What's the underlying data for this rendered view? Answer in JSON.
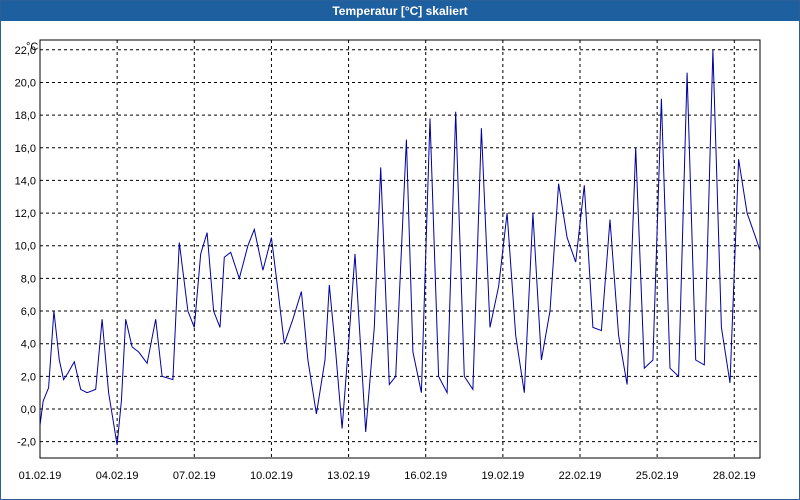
{
  "window": {
    "title": "Temperatur [°C] skaliert"
  },
  "colors": {
    "titlebar": "#1e5fa0",
    "series": "#0000a0",
    "grid": "#000000"
  },
  "chart_data": {
    "type": "line",
    "title": "Temperatur [°C] skaliert",
    "ylabel": "°C",
    "xlabel": "",
    "ylim": [
      -3,
      22.6
    ],
    "xlim": [
      "01.02.19",
      "01.03.19"
    ],
    "grid": true,
    "legend": "none",
    "yticks": [
      "-2,0",
      "0,0",
      "2,0",
      "4,0",
      "6,0",
      "8,0",
      "10,0",
      "12,0",
      "14,0",
      "16,0",
      "18,0",
      "20,0",
      "22,0"
    ],
    "xticks": [
      "01.02.19",
      "04.02.19",
      "07.02.19",
      "10.02.19",
      "13.02.19",
      "16.02.19",
      "19.02.19",
      "22.02.19",
      "25.02.19",
      "28.02.19"
    ],
    "series": [
      {
        "x": [
          "01.02.19 00:00",
          "01.02.19 03:00",
          "01.02.19 08:00",
          "01.02.19 13:00",
          "01.02.19 18:00",
          "01.02.19 22:00",
          "02.02.19 02:00",
          "02.02.19 08:00",
          "02.02.19 14:00",
          "02.02.19 20:00",
          "03.02.19 04:00",
          "03.02.19 10:00",
          "03.02.19 16:00",
          "04.02.19 00:00",
          "04.02.19 04:00",
          "04.02.19 08:00",
          "04.02.19 14:00",
          "04.02.19 20:00",
          "05.02.19 04:00",
          "05.02.19 12:00",
          "05.02.19 18:00",
          "06.02.19 04:00",
          "06.02.19 10:00",
          "06.02.19 18:00",
          "07.02.19 00:00",
          "07.02.19 06:00",
          "07.02.19 12:00",
          "07.02.19 18:00",
          "08.02.19 00:00",
          "08.02.19 04:00",
          "08.02.19 10:00",
          "08.02.19 18:00",
          "09.02.19 02:00",
          "09.02.19 08:00",
          "09.02.19 16:00",
          "10.02.19 00:00",
          "10.02.19 06:00",
          "10.02.19 12:00",
          "10.02.19 20:00",
          "11.02.19 04:00",
          "11.02.19 10:00",
          "11.02.19 18:00",
          "12.02.19 02:00",
          "12.02.19 06:00",
          "12.02.19 12:00",
          "12.02.19 18:00",
          "13.02.19 00:00",
          "13.02.19 06:00",
          "13.02.19 12:00",
          "13.02.19 16:00",
          "14.02.19 00:00",
          "14.02.19 06:00",
          "14.02.19 14:00",
          "14.02.19 20:00",
          "15.02.19 06:00",
          "15.02.19 12:00",
          "15.02.19 20:00",
          "16.02.19 04:00",
          "16.02.19 12:00",
          "16.02.19 20:00",
          "17.02.19 04:00",
          "17.02.19 12:00",
          "17.02.19 20:00",
          "18.02.19 04:00",
          "18.02.19 12:00",
          "18.02.19 20:00",
          "19.02.19 04:00",
          "19.02.19 12:00",
          "19.02.19 20:00",
          "20.02.19 04:00",
          "20.02.19 12:00",
          "20.02.19 20:00",
          "21.02.19 04:00",
          "21.02.19 12:00",
          "21.02.19 20:00",
          "22.02.19 04:00",
          "22.02.19 12:00",
          "22.02.19 20:00",
          "23.02.19 04:00",
          "23.02.19 12:00",
          "23.02.19 20:00",
          "24.02.19 04:00",
          "24.02.19 12:00",
          "24.02.19 20:00",
          "25.02.19 04:00",
          "25.02.19 12:00",
          "25.02.19 20:00",
          "26.02.19 04:00",
          "26.02.19 12:00",
          "26.02.19 20:00",
          "27.02.19 04:00",
          "27.02.19 12:00",
          "27.02.19 20:00",
          "28.02.19 04:00",
          "28.02.19 12:00",
          "28.02.19 20:00",
          "01.03.19 00:00"
        ],
        "values": [
          -1.0,
          0.5,
          1.3,
          6.0,
          3.0,
          1.8,
          2.2,
          2.9,
          1.2,
          1.0,
          1.2,
          5.5,
          1.0,
          -2.2,
          0.5,
          5.5,
          3.8,
          3.5,
          2.8,
          5.5,
          2.0,
          1.8,
          10.2,
          6.0,
          5.0,
          9.5,
          10.8,
          6.0,
          5.0,
          9.3,
          9.6,
          8.0,
          10.0,
          11.0,
          8.5,
          10.5,
          7.3,
          4.0,
          5.5,
          7.2,
          3.0,
          -0.3,
          3.0,
          7.6,
          3.5,
          -1.2,
          4.0,
          9.5,
          3.0,
          -1.4,
          5.0,
          14.8,
          1.5,
          2.0,
          16.5,
          3.5,
          1.0,
          17.8,
          2.0,
          1.0,
          18.2,
          2.0,
          1.2,
          17.2,
          5.0,
          7.5,
          12.0,
          4.5,
          1.0,
          12.0,
          3.0,
          6.0,
          13.8,
          10.5,
          9.0,
          13.7,
          5.0,
          4.8,
          11.6,
          4.5,
          1.5,
          16.0,
          2.5,
          3.0,
          19.0,
          2.5,
          2.0,
          20.6,
          3.0,
          2.7,
          22.0,
          5.0,
          1.6,
          15.3,
          12.0,
          10.5,
          9.7
        ],
        "color": "#0000a0"
      }
    ]
  }
}
